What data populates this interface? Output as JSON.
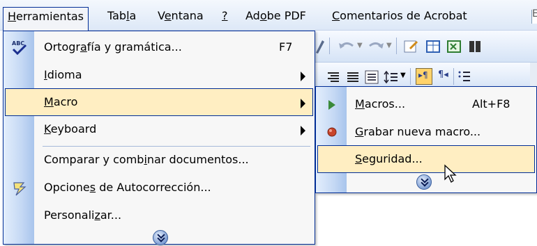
{
  "menubar": {
    "items": [
      {
        "label": "Herramientas"
      },
      {
        "label": "Tabla"
      },
      {
        "label": "Ventana"
      },
      {
        "label": "?"
      },
      {
        "label": "Adobe PDF"
      },
      {
        "label": "Comentarios de Acrobat"
      }
    ],
    "overflow_char": "E"
  },
  "tools_menu": {
    "items": [
      {
        "label": "Ortografía y gramática...",
        "shortcut": "F7",
        "icon": "spellcheck-icon"
      },
      {
        "label": "Idioma",
        "submenu": true
      },
      {
        "label": "Macro",
        "submenu": true,
        "highlighted": true
      },
      {
        "label": "Keyboard",
        "submenu": true
      },
      {
        "label": "Comparar y combinar documentos..."
      },
      {
        "label": "Opciones de Autocorrección...",
        "icon": "autocorrect-icon"
      },
      {
        "label": "Personalizar..."
      }
    ]
  },
  "macro_submenu": {
    "items": [
      {
        "label": "Macros...",
        "shortcut": "Alt+F8",
        "icon": "play-icon"
      },
      {
        "label": "Grabar nueva macro...",
        "icon": "record-icon"
      },
      {
        "label": "Seguridad...",
        "highlighted": true
      }
    ]
  },
  "colors": {
    "highlight": "#ffeec2",
    "menu_border": "#002d96",
    "gutter": "#c4d8f4"
  }
}
